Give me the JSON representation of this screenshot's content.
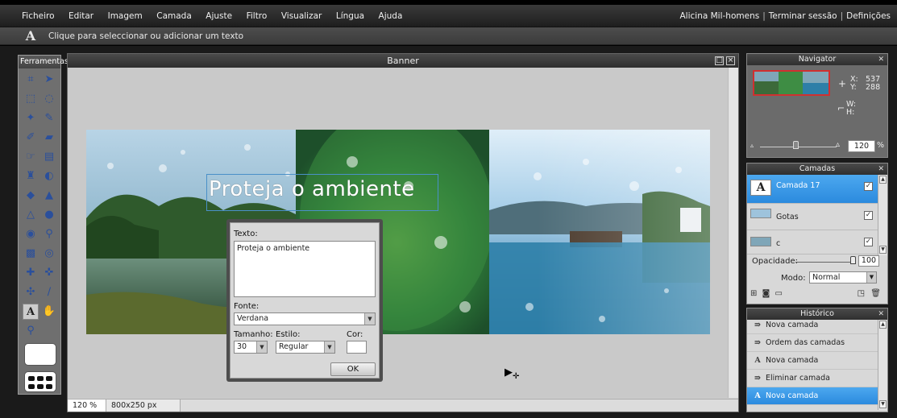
{
  "menubar": {
    "items": [
      "Ficheiro",
      "Editar",
      "Imagem",
      "Camada",
      "Ajuste",
      "Filtro",
      "Visualizar",
      "Língua",
      "Ajuda"
    ],
    "user": "Alicina Mil-homens",
    "logout": "Terminar sessão",
    "settings": "Definições"
  },
  "options_bar": {
    "tool_icon": "A",
    "hint": "Clique para seleccionar ou adicionar um texto"
  },
  "toolbox": {
    "title": "Ferramentas",
    "tools": [
      "crop-icon",
      "move-icon",
      "marquee-icon",
      "lasso-icon",
      "magic-wand-icon",
      "pencil-icon",
      "brush-icon",
      "eraser-icon",
      "smudge-icon",
      "gradient-icon",
      "stamp-icon",
      "color-replace-icon",
      "bucket-icon",
      "drop-icon",
      "sharpen-icon",
      "dodge-icon",
      "burn-icon",
      "zoom-icon",
      "sponge-icon",
      "red-eye-icon",
      "spot-heal-icon",
      "bloat-icon",
      "pinch-icon",
      "eyedropper-icon",
      "text-icon",
      "hand-icon",
      "zoom-out-icon"
    ]
  },
  "banner_window": {
    "title": "Banner",
    "zoom": "120 %",
    "size": "800x250 px",
    "banner_text": "Proteja o ambiente"
  },
  "text_dialog": {
    "text_label": "Texto:",
    "text_value": "Proteja o ambiente",
    "font_label": "Fonte:",
    "font_value": "Verdana",
    "size_label": "Tamanho:",
    "size_value": "30",
    "style_label": "Estilo:",
    "style_value": "Regular",
    "color_label": "Cor:",
    "ok": "OK"
  },
  "navigator": {
    "title": "Navigator",
    "x_label": "X:",
    "x_value": "537",
    "y_label": "Y:",
    "y_value": "288",
    "w_label": "W:",
    "h_label": "H:",
    "zoom": "120",
    "pct": "%"
  },
  "layers": {
    "title": "Camadas",
    "items": [
      {
        "name": "Camada 17",
        "thumb": "A"
      },
      {
        "name": "Gotas"
      },
      {
        "name": "c"
      }
    ],
    "opacity_label": "Opacidade:",
    "opacity_value": "100",
    "mode_label": "Modo:",
    "mode_value": "Normal"
  },
  "history": {
    "title": "Histórico",
    "items": [
      {
        "label": "Nova camada",
        "icon": "layer-icon"
      },
      {
        "label": "Ordem das camadas",
        "icon": "layer-icon"
      },
      {
        "label": "Nova camada",
        "icon": "text-icon"
      },
      {
        "label": "Eliminar camada",
        "icon": "layer-icon"
      },
      {
        "label": "Nova camada",
        "icon": "text-icon"
      }
    ]
  },
  "colors": {
    "selection": "#2b8ade",
    "panel_bg": "#d8d8d8",
    "chrome_dark": "#2e2e2e"
  }
}
